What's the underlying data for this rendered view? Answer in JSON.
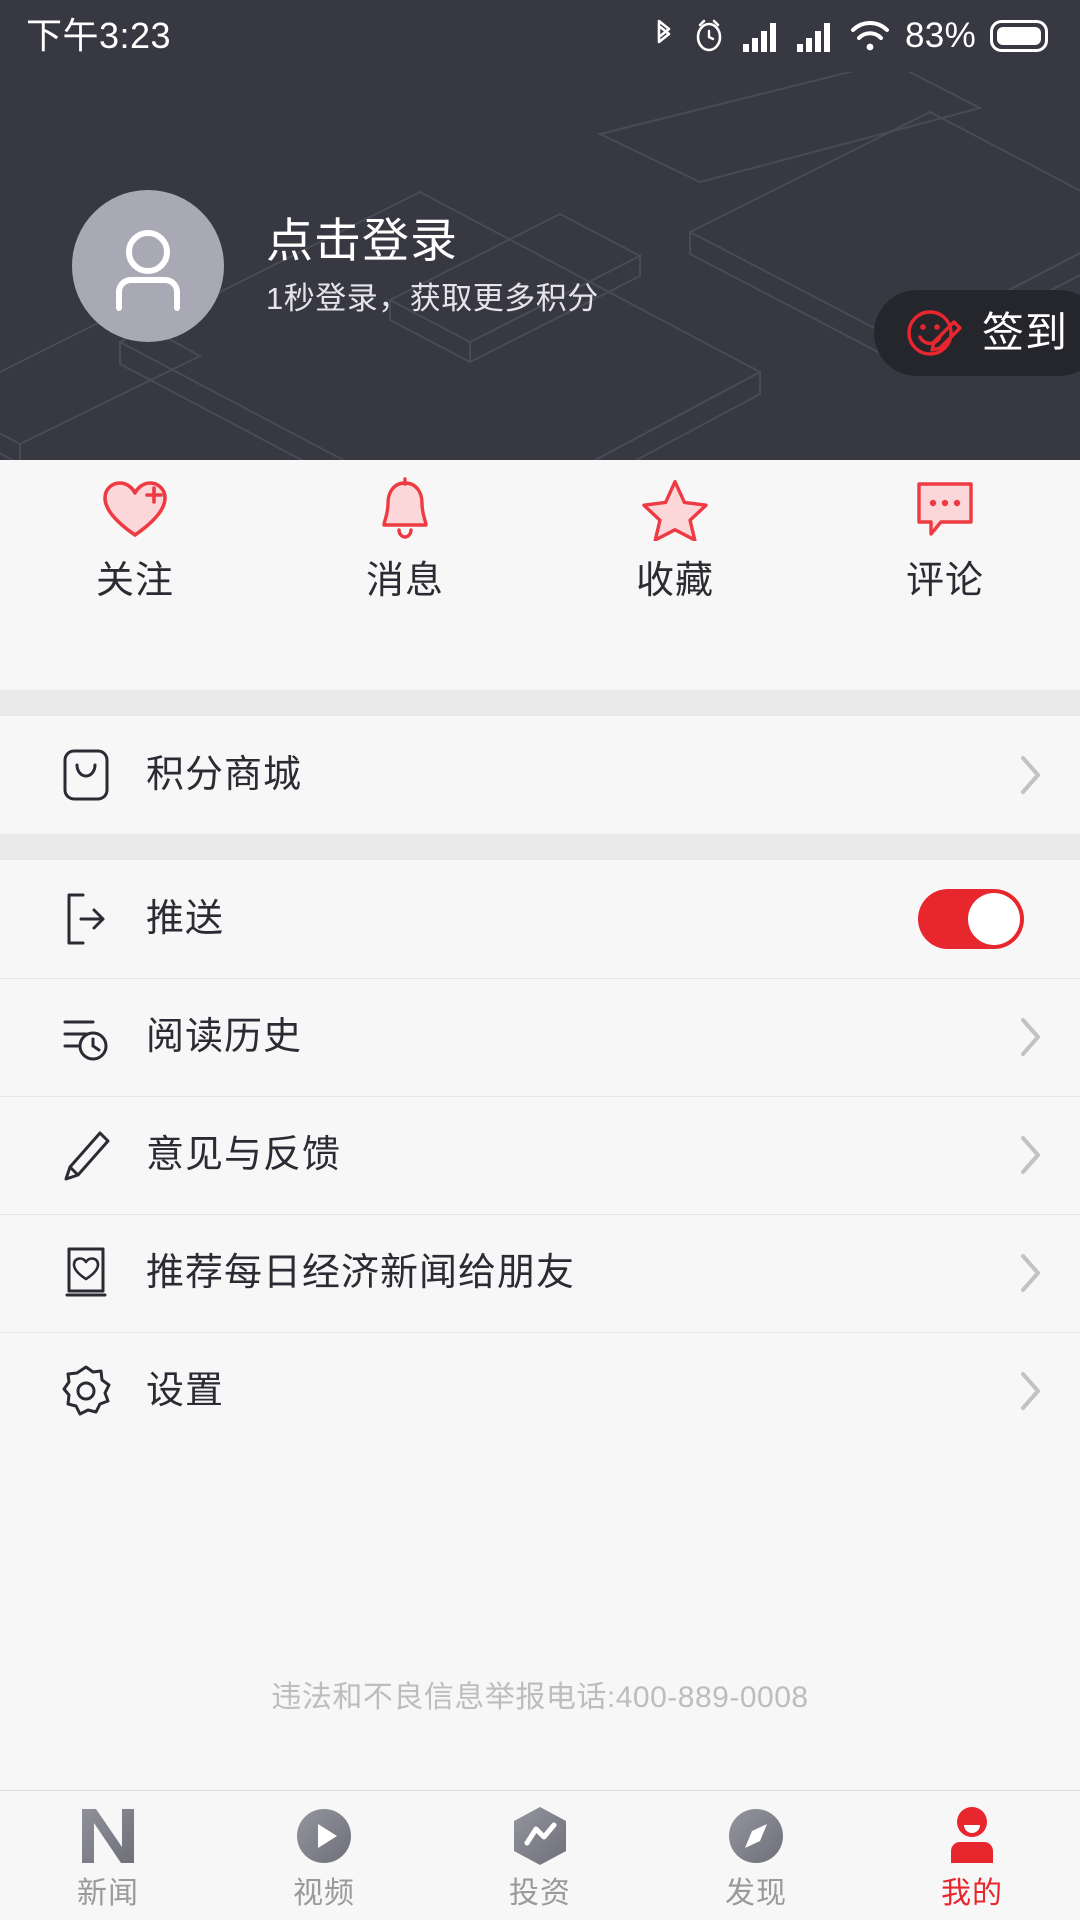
{
  "status_bar": {
    "time": "下午3:23",
    "battery_percent": "83%",
    "icons": [
      "bluetooth-icon",
      "alarm-icon",
      "signal-sim1-icon",
      "signal-sim2-icon",
      "wifi-icon",
      "battery-icon"
    ]
  },
  "header": {
    "avatar_icon": "person-avatar-icon",
    "login_title": "点击登录",
    "login_subtitle": "1秒登录，获取更多积分",
    "checkin": {
      "label": "签到",
      "icon": "smiley-pen-icon"
    },
    "background_color": "#383842",
    "accent_color": "#e8262e"
  },
  "quick_actions": [
    {
      "label": "关注",
      "icon": "heart-plus-icon"
    },
    {
      "label": "消息",
      "icon": "bell-icon"
    },
    {
      "label": "收藏",
      "icon": "star-icon"
    },
    {
      "label": "评论",
      "icon": "comment-bubble-icon"
    }
  ],
  "sections": [
    {
      "rows": [
        {
          "label": "积分商城",
          "icon": "shopping-bag-icon",
          "control": "chevron"
        }
      ]
    },
    {
      "rows": [
        {
          "label": "推送",
          "icon": "push-arrow-icon",
          "control": "toggle",
          "toggle_on": true
        },
        {
          "label": "阅读历史",
          "icon": "history-clock-icon",
          "control": "chevron"
        },
        {
          "label": "意见与反馈",
          "icon": "pencil-icon",
          "control": "chevron"
        },
        {
          "label": "推荐每日经济新闻给朋友",
          "icon": "heart-card-icon",
          "control": "chevron"
        },
        {
          "label": "设置",
          "icon": "gear-icon",
          "control": "chevron"
        }
      ]
    }
  ],
  "footer": {
    "report_text": "违法和不良信息举报电话:400-889-0008"
  },
  "tabbar": {
    "active_index": 4,
    "active_color": "#e8262e",
    "inactive_color": "#9a9a9a",
    "tabs": [
      {
        "label": "新闻",
        "icon": "nbd-logo-icon"
      },
      {
        "label": "视频",
        "icon": "play-circle-icon"
      },
      {
        "label": "投资",
        "icon": "invest-hexagon-icon"
      },
      {
        "label": "发现",
        "icon": "compass-icon"
      },
      {
        "label": "我的",
        "icon": "person-icon"
      }
    ]
  }
}
